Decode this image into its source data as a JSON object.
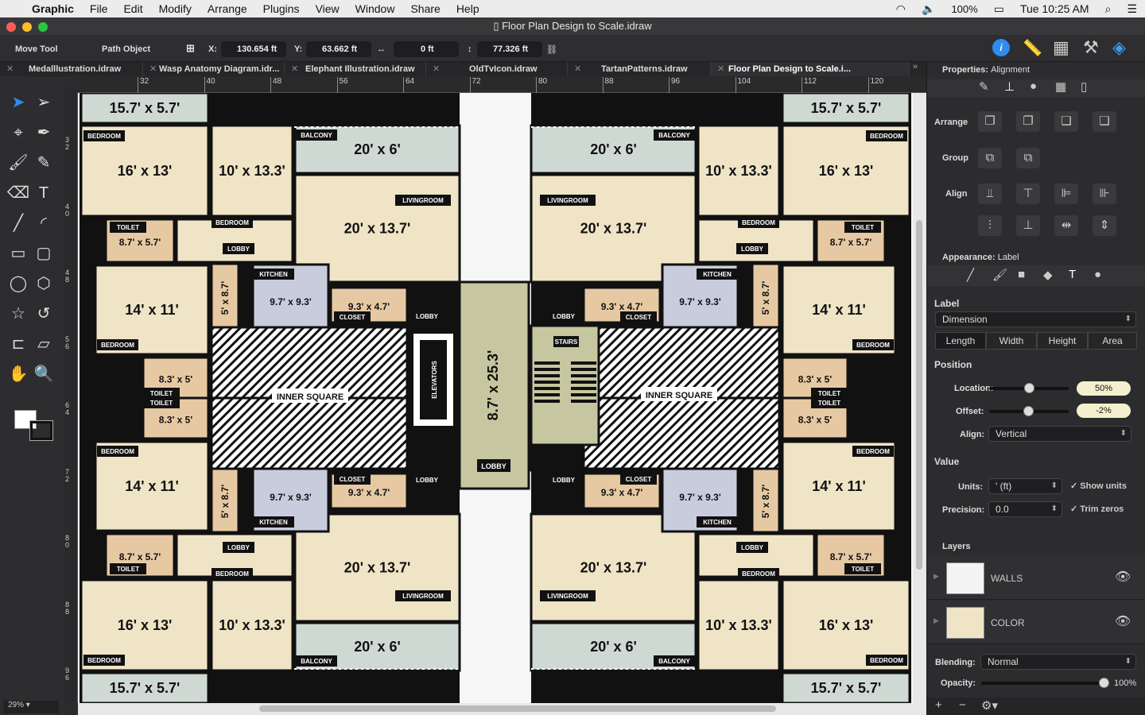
{
  "menubar": {
    "app": "Graphic",
    "items": [
      "File",
      "Edit",
      "Modify",
      "Arrange",
      "Plugins",
      "View",
      "Window",
      "Share",
      "Help"
    ],
    "battery": "100%",
    "clock": "Tue 10:25 AM"
  },
  "window": {
    "title": "Floor Plan Design to Scale.idraw"
  },
  "toolbar": {
    "tool_name": "Move Tool",
    "object_type": "Path Object",
    "x_label": "X:",
    "x_value": "130.654 ft",
    "y_label": "Y:",
    "y_value": "63.662 ft",
    "width_value": "0 ft",
    "height_value": "77.326 ft"
  },
  "tabs": [
    "Medalllustration.idraw",
    "Wasp Anatomy Diagram.idr...",
    "Elephant Illustration.idraw",
    "OldTvIcon.idraw",
    "TartanPatterns.idraw",
    "Floor Plan Design to Scale.i..."
  ],
  "ruler": {
    "h": [
      "32",
      "40",
      "48",
      "56",
      "64",
      "72",
      "80",
      "88",
      "96",
      "104",
      "112",
      "120"
    ],
    "v": [
      "3 2",
      "4 0",
      "4 8",
      "5 6",
      "6 4",
      "7 2",
      "8 0",
      "8 8",
      "9 6"
    ]
  },
  "zoom": "29%",
  "plan": {
    "dims": {
      "strip": "15.7' x 5.7'",
      "bed_big": "16' x 13'",
      "bed_mid": "10' x 13.3'",
      "balcony": "20' x 6'",
      "living": "20' x 13.7'",
      "toilet_a": "8.7' x 5.7'",
      "bed_small": "14' x 11'",
      "narrow": "5' x 8.7'",
      "kitchen": "9.7' x 9.3'",
      "closet": "9.3' x 4.7'",
      "toilet_b": "8.3' x 5'",
      "corridor": "8.7' x 25.3'"
    },
    "tags": {
      "bedroom": "BEDROOM",
      "balcony": "BALCONY",
      "livingroom": "LIVINGROOM",
      "toilet": "TOILET",
      "lobby": "LOBBY",
      "kitchen": "KITCHEN",
      "closet": "CLOSET",
      "inner_square": "INNER SQUARE",
      "elevators": "ELEVATORS",
      "stairs": "STAIRS"
    },
    "colors": {
      "bedroom": "#efe4c6",
      "service": "#e6c9a3",
      "balcony": "#cfd9d4",
      "kitchen": "#c9ccdd",
      "corridor": "#c6c7a0",
      "wall": "#111111"
    }
  },
  "panel": {
    "header_label": "Properties:",
    "header_value": "Alignment",
    "arrange": "Arrange",
    "group": "Group",
    "align": "Align",
    "appearance_label": "Appearance:",
    "appearance_value": "Label",
    "label_heading": "Label",
    "label_type": "Dimension",
    "segments": [
      "Length",
      "Width",
      "Height",
      "Area"
    ],
    "position_heading": "Position",
    "location_label": "Location:",
    "location_value": "50%",
    "offset_label": "Offset:",
    "offset_value": "-2%",
    "location_pct": 50,
    "offset_pct": -2,
    "align_label": "Align:",
    "align_value": "Vertical",
    "value_heading": "Value",
    "units_label": "Units:",
    "units_value": "' (ft)",
    "show_units": "Show units",
    "precision_label": "Precision:",
    "precision_value": "0.0",
    "trim_zeros": "Trim zeros",
    "layers_heading": "Layers",
    "layers": [
      "WALLS",
      "COLOR"
    ],
    "blending_label": "Blending:",
    "blending_value": "Normal",
    "opacity_label": "Opacity:",
    "opacity_value": "100%"
  }
}
